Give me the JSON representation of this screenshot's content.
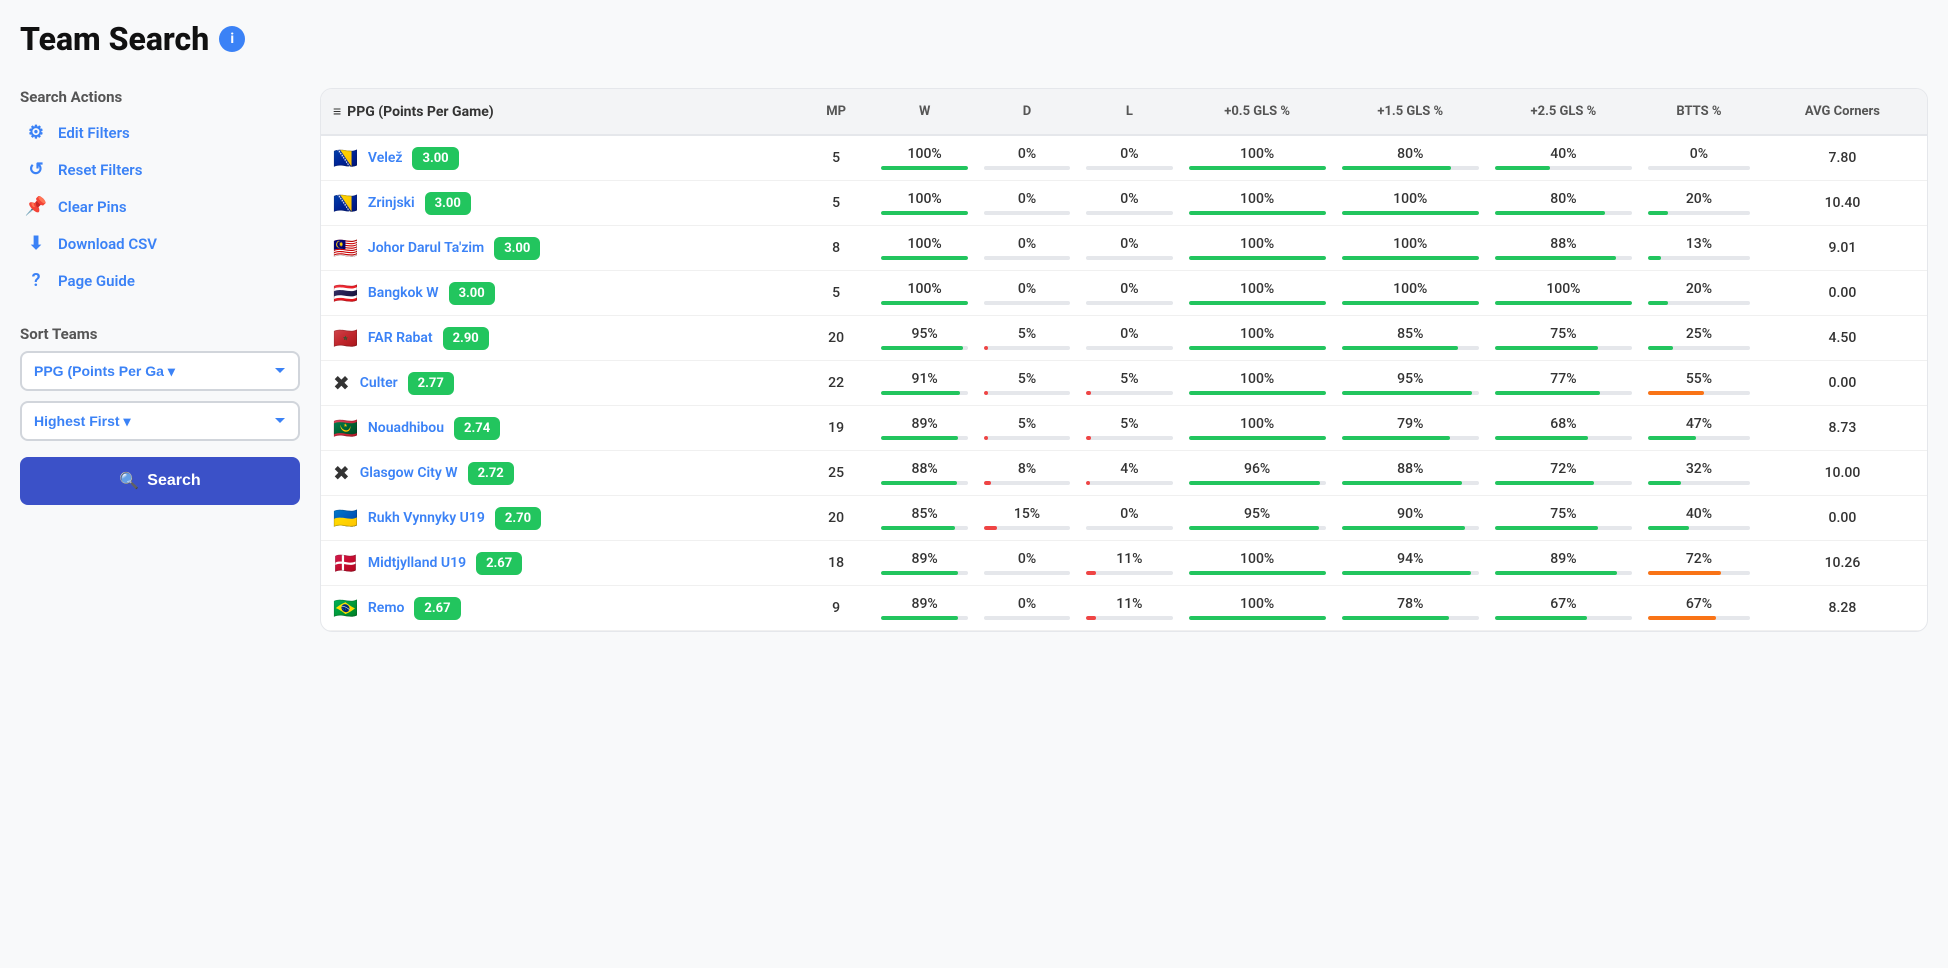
{
  "page": {
    "title": "Team Search",
    "info_icon": "i"
  },
  "sidebar": {
    "search_actions_label": "Search Actions",
    "actions": [
      {
        "id": "edit-filters",
        "icon": "⚙",
        "label": "Edit Filters"
      },
      {
        "id": "reset-filters",
        "icon": "↺",
        "label": "Reset Filters"
      },
      {
        "id": "clear-pins",
        "icon": "📌",
        "label": "Clear Pins"
      },
      {
        "id": "download-csv",
        "icon": "⬇",
        "label": "Download CSV"
      },
      {
        "id": "page-guide",
        "icon": "?",
        "label": "Page Guide"
      }
    ],
    "sort_teams_label": "Sort Teams",
    "sort_options": [
      {
        "value": "ppg",
        "label": "PPG (Points Per Ga"
      },
      {
        "value": "highest",
        "label": "Highest First"
      }
    ],
    "sort_selected": "PPG (Points Per Ga",
    "order_selected": "Highest First",
    "search_button_label": "Search"
  },
  "table": {
    "sort_icon": "≡",
    "col_team": "PPG (Points Per Game)",
    "col_mp": "MP",
    "col_w": "W",
    "col_d": "D",
    "col_l": "L",
    "col_05gls": "+0.5 GLS %",
    "col_15gls": "+1.5 GLS %",
    "col_25gls": "+2.5 GLS %",
    "col_btts": "BTTS %",
    "col_avgcorners": "AVG Corners",
    "rows": [
      {
        "flag": "🇧🇦",
        "team": "Velež",
        "ppg": "3.00",
        "mp": 5,
        "w": "100%",
        "w_pct": 100,
        "d": "0%",
        "d_pct": 0,
        "l": "0%",
        "l_pct": 0,
        "gls05": "100%",
        "gls05_pct": 100,
        "gls15": "80%",
        "gls15_pct": 80,
        "gls25": "40%",
        "gls25_pct": 40,
        "btts": "0%",
        "btts_pct": 0,
        "avg_corners": "7.80"
      },
      {
        "flag": "🇧🇦",
        "team": "Zrinjski",
        "ppg": "3.00",
        "mp": 5,
        "w": "100%",
        "w_pct": 100,
        "d": "0%",
        "d_pct": 0,
        "l": "0%",
        "l_pct": 0,
        "gls05": "100%",
        "gls05_pct": 100,
        "gls15": "100%",
        "gls15_pct": 100,
        "gls25": "80%",
        "gls25_pct": 80,
        "btts": "20%",
        "btts_pct": 20,
        "avg_corners": "10.40"
      },
      {
        "flag": "🇲🇾",
        "team": "Johor Darul Ta'zim",
        "ppg": "3.00",
        "mp": 8,
        "w": "100%",
        "w_pct": 100,
        "d": "0%",
        "d_pct": 0,
        "l": "0%",
        "l_pct": 0,
        "gls05": "100%",
        "gls05_pct": 100,
        "gls15": "100%",
        "gls15_pct": 100,
        "gls25": "88%",
        "gls25_pct": 88,
        "btts": "13%",
        "btts_pct": 13,
        "avg_corners": "9.01"
      },
      {
        "flag": "🇹🇭",
        "team": "Bangkok W",
        "ppg": "3.00",
        "mp": 5,
        "w": "100%",
        "w_pct": 100,
        "d": "0%",
        "d_pct": 0,
        "l": "0%",
        "l_pct": 0,
        "gls05": "100%",
        "gls05_pct": 100,
        "gls15": "100%",
        "gls15_pct": 100,
        "gls25": "100%",
        "gls25_pct": 100,
        "btts": "20%",
        "btts_pct": 20,
        "avg_corners": "0.00"
      },
      {
        "flag": "🇲🇦",
        "team": "FAR Rabat",
        "ppg": "2.90",
        "mp": 20,
        "w": "95%",
        "w_pct": 95,
        "d": "5%",
        "d_pct": 5,
        "l": "0%",
        "l_pct": 0,
        "gls05": "100%",
        "gls05_pct": 100,
        "gls15": "85%",
        "gls15_pct": 85,
        "gls25": "75%",
        "gls25_pct": 75,
        "btts": "25%",
        "btts_pct": 25,
        "avg_corners": "4.50"
      },
      {
        "flag": "✖",
        "team": "Culter",
        "ppg": "2.77",
        "mp": 22,
        "w": "91%",
        "w_pct": 91,
        "d": "5%",
        "d_pct": 5,
        "l": "5%",
        "l_pct": 5,
        "gls05": "100%",
        "gls05_pct": 100,
        "gls15": "95%",
        "gls15_pct": 95,
        "gls25": "77%",
        "gls25_pct": 77,
        "btts": "55%",
        "btts_pct": 55,
        "avg_corners": "0.00"
      },
      {
        "flag": "🇲🇷",
        "team": "Nouadhibou",
        "ppg": "2.74",
        "mp": 19,
        "w": "89%",
        "w_pct": 89,
        "d": "5%",
        "d_pct": 5,
        "l": "5%",
        "l_pct": 5,
        "gls05": "100%",
        "gls05_pct": 100,
        "gls15": "79%",
        "gls15_pct": 79,
        "gls25": "68%",
        "gls25_pct": 68,
        "btts": "47%",
        "btts_pct": 47,
        "avg_corners": "8.73"
      },
      {
        "flag": "✖",
        "team": "Glasgow City W",
        "ppg": "2.72",
        "mp": 25,
        "w": "88%",
        "w_pct": 88,
        "d": "8%",
        "d_pct": 8,
        "l": "4%",
        "l_pct": 4,
        "gls05": "96%",
        "gls05_pct": 96,
        "gls15": "88%",
        "gls15_pct": 88,
        "gls25": "72%",
        "gls25_pct": 72,
        "btts": "32%",
        "btts_pct": 32,
        "avg_corners": "10.00"
      },
      {
        "flag": "🇺🇦",
        "team": "Rukh Vynnyky U19",
        "ppg": "2.70",
        "mp": 20,
        "w": "85%",
        "w_pct": 85,
        "d": "15%",
        "d_pct": 15,
        "l": "0%",
        "l_pct": 0,
        "gls05": "95%",
        "gls05_pct": 95,
        "gls15": "90%",
        "gls15_pct": 90,
        "gls25": "75%",
        "gls25_pct": 75,
        "btts": "40%",
        "btts_pct": 40,
        "avg_corners": "0.00"
      },
      {
        "flag": "🇩🇰",
        "team": "Midtjylland U19",
        "ppg": "2.67",
        "mp": 18,
        "w": "89%",
        "w_pct": 89,
        "d": "0%",
        "d_pct": 0,
        "l": "11%",
        "l_pct": 11,
        "gls05": "100%",
        "gls05_pct": 100,
        "gls15": "94%",
        "gls15_pct": 94,
        "gls25": "89%",
        "gls25_pct": 89,
        "btts": "72%",
        "btts_pct": 72,
        "avg_corners": "10.26"
      },
      {
        "flag": "🇧🇷",
        "team": "Remo",
        "ppg": "2.67",
        "mp": 9,
        "w": "89%",
        "w_pct": 89,
        "d": "0%",
        "d_pct": 0,
        "l": "11%",
        "l_pct": 11,
        "gls05": "100%",
        "gls05_pct": 100,
        "gls15": "78%",
        "gls15_pct": 78,
        "gls25": "67%",
        "gls25_pct": 67,
        "btts": "67%",
        "btts_pct": 67,
        "avg_corners": "8.28"
      }
    ]
  }
}
